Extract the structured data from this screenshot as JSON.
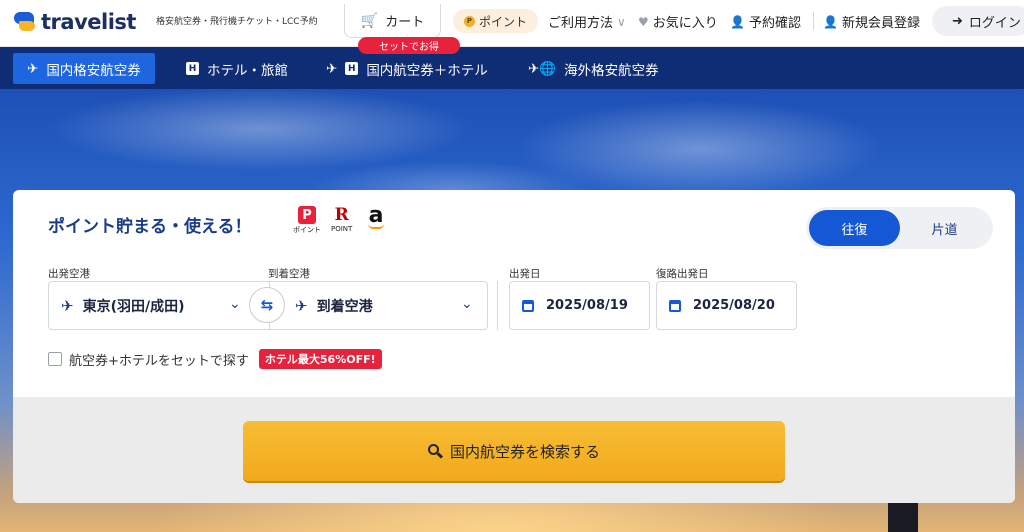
{
  "header": {
    "logo_text": "travelist",
    "tagline": "格安航空券・飛行機チケット・LCC予約",
    "cart_label": "カート",
    "set_badge": "セットでお得",
    "points_label": "ポイント",
    "points_coin": "P",
    "usage_label": "ご利用方法",
    "favorites_label": "お気に入り",
    "reservation_label": "予約確認",
    "register_label": "新規会員登録",
    "login_label": "ログイン"
  },
  "nav": {
    "tabs": [
      {
        "label": "国内格安航空券",
        "active": true
      },
      {
        "label": "ホテル・旅館",
        "active": false
      },
      {
        "label": "国内航空券＋ホテル",
        "active": false
      },
      {
        "label": "海外格安航空券",
        "active": false
      }
    ],
    "hotel_icon_letter": "H"
  },
  "search": {
    "headline": "ポイント貯まる・使える！",
    "pay_logos": {
      "paypay_mark": "P",
      "paypay_caption": "ポイント",
      "rakuten_mark": "R",
      "rakuten_caption": "POINT",
      "amazon_mark": "a"
    },
    "trip_types": [
      "往復",
      "片道"
    ],
    "selected_trip": "往復",
    "departure_label": "出発空港",
    "departure_value": "東京(羽田/成田)",
    "arrival_label": "到着空港",
    "arrival_value": "到着空港",
    "depart_date_label": "出発日",
    "depart_date": "2025/08/19",
    "return_date_label": "復路出発日",
    "return_date": "2025/08/20",
    "hotel_set_label": "航空券+ホテルをセットで探す",
    "hotel_set_checked": false,
    "discount_badge": "ホテル最大56%OFF!",
    "search_button": "国内航空券を検索する"
  },
  "colors": {
    "brand_navy": "#0f2d74",
    "brand_blue": "#1e66e0",
    "cta_yellow": "#f4b128",
    "accent_red": "#e8223d"
  }
}
